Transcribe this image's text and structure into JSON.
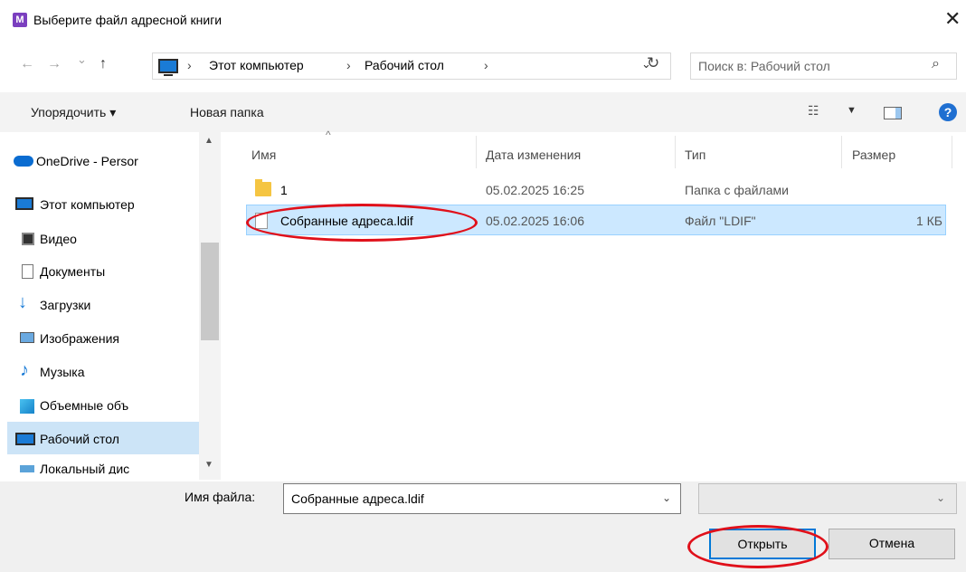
{
  "window": {
    "app_icon_letter": "M",
    "title": "Выберите файл адресной книги",
    "close_glyph": "✕"
  },
  "nav": {
    "back_glyph": "←",
    "forward_glyph": "→",
    "recent_glyph": "⌄",
    "up_glyph": "↑",
    "breadcrumb": [
      "Этот компьютер",
      "Рабочий стол"
    ],
    "breadcrumb_sep": "›",
    "refresh_glyph": "↻",
    "search_placeholder": "Поиск в: Рабочий стол",
    "search_icon": "search-icon"
  },
  "toolbar": {
    "organize_label": "Упорядочить ▾",
    "new_folder_label": "Новая папка",
    "view_caret": "▼",
    "help_glyph": "?"
  },
  "sidebar": {
    "items": [
      {
        "label": "OneDrive - Persor",
        "icon": "cloud-icon"
      },
      {
        "label": "Этот компьютер",
        "icon": "computer-icon"
      },
      {
        "label": "Видео",
        "icon": "video-icon"
      },
      {
        "label": "Документы",
        "icon": "documents-icon"
      },
      {
        "label": "Загрузки",
        "icon": "downloads-icon"
      },
      {
        "label": "Изображения",
        "icon": "pictures-icon"
      },
      {
        "label": "Музыка",
        "icon": "music-icon"
      },
      {
        "label": "Объемные объ",
        "icon": "3d-objects-icon"
      },
      {
        "label": "Рабочий стол",
        "icon": "desktop-icon",
        "selected": true
      },
      {
        "label": "Локальный дис",
        "icon": "drive-icon"
      }
    ]
  },
  "file_list": {
    "columns": [
      "Имя",
      "Дата изменения",
      "Тип",
      "Размер"
    ],
    "rows": [
      {
        "name": "1",
        "modified": "05.02.2025 16:25",
        "type": "Папка с файлами",
        "size": "",
        "icon": "folder-icon"
      },
      {
        "name": "Собранные адреса.ldif",
        "modified": "05.02.2025 16:06",
        "type": "Файл \"LDIF\"",
        "size": "1 КБ",
        "icon": "file-icon",
        "selected": true
      }
    ]
  },
  "footer": {
    "filename_label": "Имя файла:",
    "filename_value": "Собранные адреса.ldif",
    "filter_value": "",
    "open_label": "Открыть",
    "cancel_label": "Отмена"
  },
  "colors": {
    "selection": "#cce8ff",
    "annotation": "#e0101a",
    "accent": "#0078d7"
  }
}
